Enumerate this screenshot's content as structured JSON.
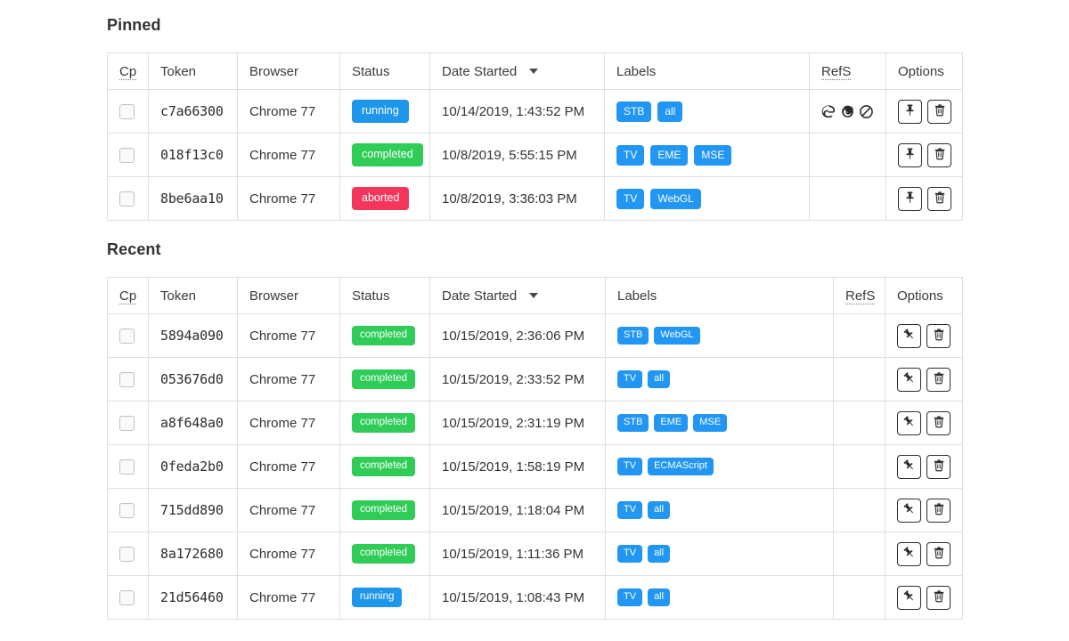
{
  "columns": {
    "cp": "Cp",
    "cp_title": "Completed",
    "token": "Token",
    "browser": "Browser",
    "status": "Status",
    "date_started": "Date Started",
    "labels": "Labels",
    "refs": "RefS",
    "refs_title": "Reference Screenshots",
    "options": "Options",
    "sort_icon": "caret-down-icon"
  },
  "status_colors": {
    "running": "#1e96ec",
    "completed": "#2fcc58",
    "aborted": "#f4365c",
    "label": "#2196f3"
  },
  "actions": {
    "pin_icon": "pin-icon",
    "unpin_icon": "pin-angle-icon",
    "delete_icon": "trash-icon"
  },
  "sections": [
    {
      "id": "pinned",
      "title": "Pinned",
      "rows": [
        {
          "checked": false,
          "token": "c7a66300",
          "browser": "Chrome 77",
          "status": "running",
          "date": "10/14/2019, 1:43:52 PM",
          "labels": [
            "STB",
            "all"
          ],
          "refs": [
            "edge-icon",
            "firefox-icon",
            "ban-icon"
          ],
          "pinned": true
        },
        {
          "checked": false,
          "token": "018f13c0",
          "browser": "Chrome 77",
          "status": "completed",
          "date": "10/8/2019, 5:55:15 PM",
          "labels": [
            "TV",
            "EME",
            "MSE"
          ],
          "refs": [],
          "pinned": true
        },
        {
          "checked": false,
          "token": "8be6aa10",
          "browser": "Chrome 77",
          "status": "aborted",
          "date": "10/8/2019, 3:36:03 PM",
          "labels": [
            "TV",
            "WebGL"
          ],
          "refs": [],
          "pinned": true
        }
      ]
    },
    {
      "id": "recent",
      "title": "Recent",
      "rows": [
        {
          "checked": false,
          "token": "5894a090",
          "browser": "Chrome 77",
          "status": "completed",
          "date": "10/15/2019, 2:36:06 PM",
          "labels": [
            "STB",
            "WebGL"
          ],
          "refs": [],
          "pinned": false
        },
        {
          "checked": false,
          "token": "053676d0",
          "browser": "Chrome 77",
          "status": "completed",
          "date": "10/15/2019, 2:33:52 PM",
          "labels": [
            "TV",
            "all"
          ],
          "refs": [],
          "pinned": false
        },
        {
          "checked": false,
          "token": "a8f648a0",
          "browser": "Chrome 77",
          "status": "completed",
          "date": "10/15/2019, 2:31:19 PM",
          "labels": [
            "STB",
            "EME",
            "MSE"
          ],
          "refs": [],
          "pinned": false
        },
        {
          "checked": false,
          "token": "0feda2b0",
          "browser": "Chrome 77",
          "status": "completed",
          "date": "10/15/2019, 1:58:19 PM",
          "labels": [
            "TV",
            "ECMAScript"
          ],
          "refs": [],
          "pinned": false
        },
        {
          "checked": false,
          "token": "715dd890",
          "browser": "Chrome 77",
          "status": "completed",
          "date": "10/15/2019, 1:18:04 PM",
          "labels": [
            "TV",
            "all"
          ],
          "refs": [],
          "pinned": false
        },
        {
          "checked": false,
          "token": "8a172680",
          "browser": "Chrome 77",
          "status": "completed",
          "date": "10/15/2019, 1:11:36 PM",
          "labels": [
            "TV",
            "all"
          ],
          "refs": [],
          "pinned": false
        },
        {
          "checked": false,
          "token": "21d56460",
          "browser": "Chrome 77",
          "status": "running",
          "date": "10/15/2019, 1:08:43 PM",
          "labels": [
            "TV",
            "all"
          ],
          "refs": [],
          "pinned": false
        }
      ]
    }
  ]
}
